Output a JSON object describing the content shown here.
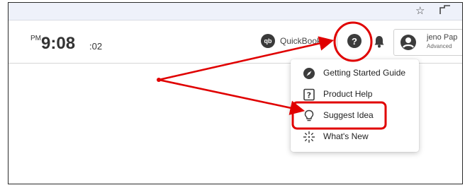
{
  "browser_bar": {
    "star_icon": "star-icon",
    "extensions_icon": "extensions-icon"
  },
  "clock": {
    "ampm": "PM",
    "hours_minutes": "9:08",
    "seconds": ":02"
  },
  "header": {
    "quickbooks_logo_text": "qb",
    "quickbooks_label": "QuickBooks",
    "help_icon_glyph": "?",
    "bell_icon": "bell-icon"
  },
  "profile": {
    "name": "jeno Pap",
    "level": "Advanced"
  },
  "help_menu": {
    "items": [
      {
        "label": "Getting Started Guide",
        "icon": "compass-icon"
      },
      {
        "label": "Product Help",
        "icon": "question-box-icon"
      },
      {
        "label": "Suggest Idea",
        "icon": "lightbulb-icon"
      },
      {
        "label": "What's New",
        "icon": "sparkle-icon"
      }
    ]
  },
  "annotations": {
    "color": "#e00000"
  }
}
